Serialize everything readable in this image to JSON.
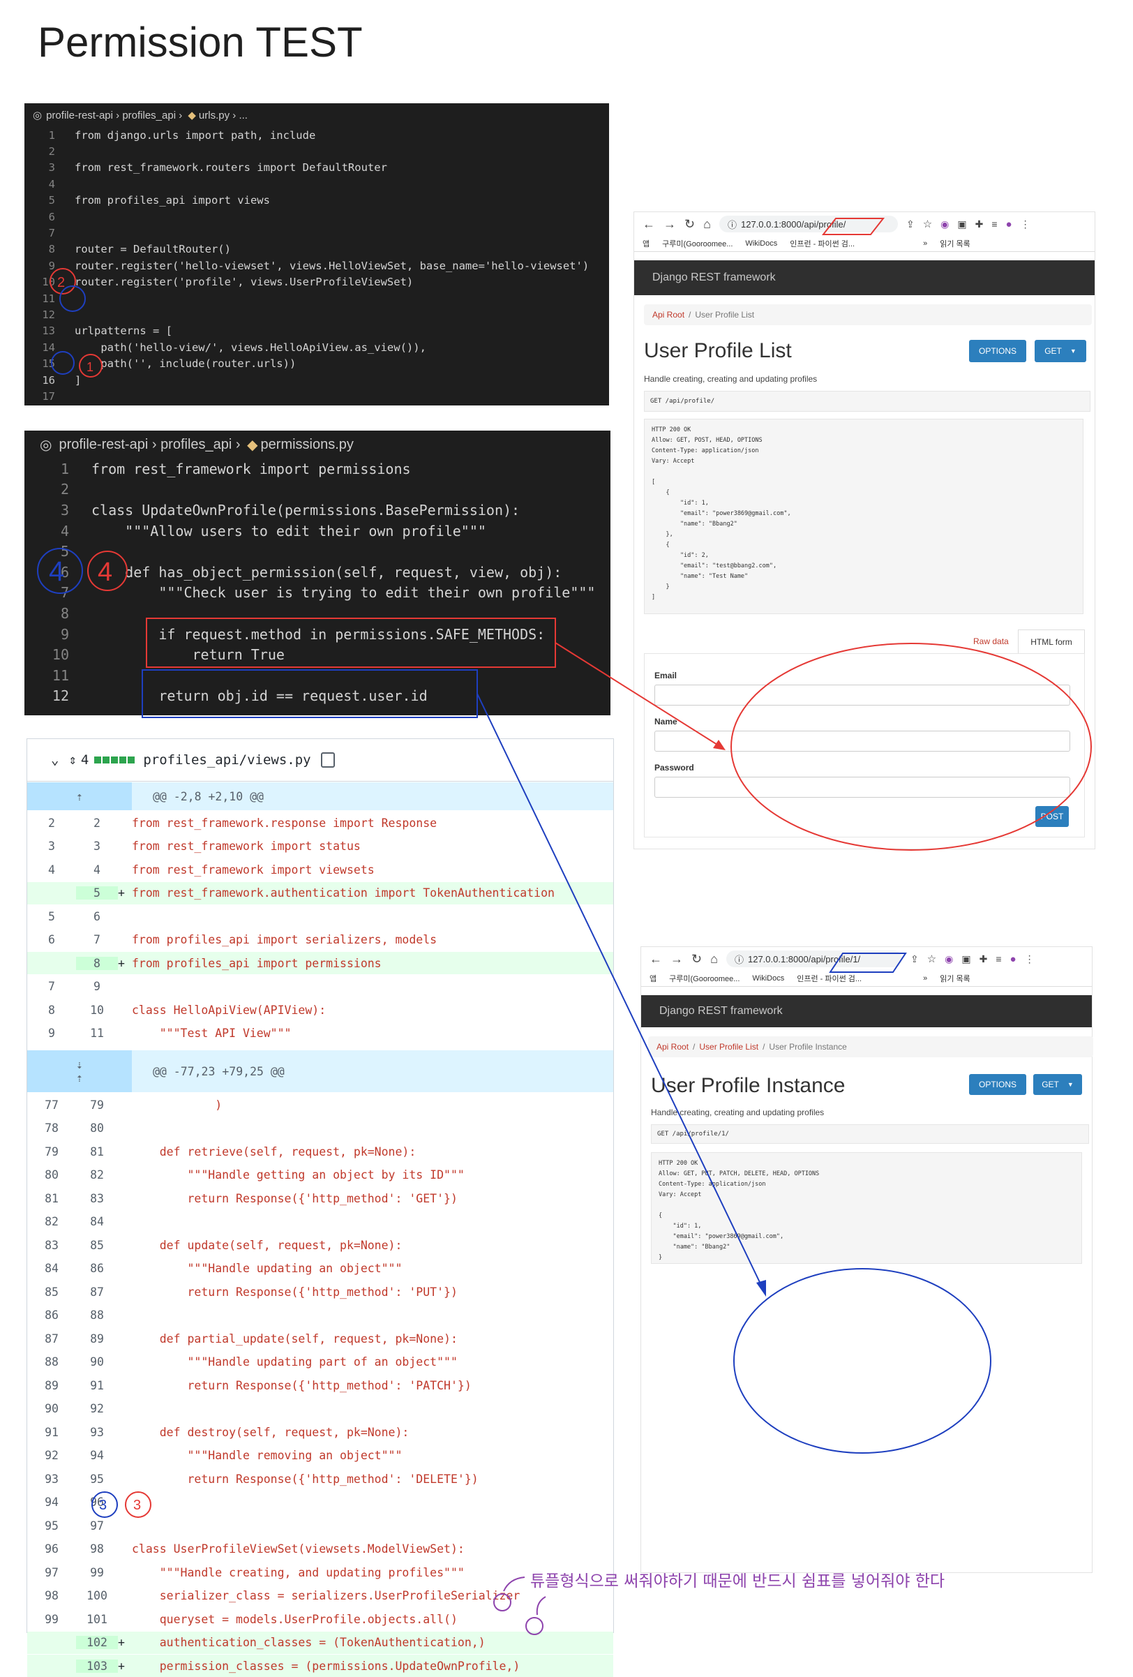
{
  "page": {
    "title": "Permission TEST"
  },
  "urls_editor": {
    "breadcrumb": [
      "profile-rest-api",
      "profiles_api",
      "urls.py",
      "..."
    ],
    "lines": [
      {
        "n": "1",
        "code": "from django.urls import path, include"
      },
      {
        "n": "2",
        "code": ""
      },
      {
        "n": "3",
        "code": "from rest_framework.routers import DefaultRouter"
      },
      {
        "n": "4",
        "code": ""
      },
      {
        "n": "5",
        "code": "from profiles_api import views"
      },
      {
        "n": "6",
        "code": ""
      },
      {
        "n": "7",
        "code": ""
      },
      {
        "n": "8",
        "code": "router = DefaultRouter()"
      },
      {
        "n": "9",
        "code": "router.register('hello-viewset', views.HelloViewSet, base_name='hello-viewset')"
      },
      {
        "n": "10",
        "code": "router.register('profile', views.UserProfileViewSet)"
      },
      {
        "n": "11",
        "code": ""
      },
      {
        "n": "12",
        "code": ""
      },
      {
        "n": "13",
        "code": "urlpatterns = ["
      },
      {
        "n": "14",
        "code": "    path('hello-view/', views.HelloApiView.as_view()),"
      },
      {
        "n": "15",
        "code": "    path('', include(router.urls))"
      },
      {
        "n": "16",
        "code": "]"
      },
      {
        "n": "17",
        "code": ""
      }
    ]
  },
  "perm_editor": {
    "breadcrumb": [
      "profile-rest-api",
      "profiles_api",
      "permissions.py"
    ],
    "lines": [
      {
        "n": "1",
        "code": "from rest_framework import permissions"
      },
      {
        "n": "2",
        "code": ""
      },
      {
        "n": "3",
        "code": "class UpdateOwnProfile(permissions.BasePermission):"
      },
      {
        "n": "4",
        "code": "    \"\"\"Allow users to edit their own profile\"\"\""
      },
      {
        "n": "5",
        "code": ""
      },
      {
        "n": "6",
        "code": "    def has_object_permission(self, request, view, obj):"
      },
      {
        "n": "7",
        "code": "        \"\"\"Check user is trying to edit their own profile\"\"\""
      },
      {
        "n": "8",
        "code": ""
      },
      {
        "n": "9",
        "code": "        if request.method in permissions.SAFE_METHODS:"
      },
      {
        "n": "10",
        "code": "            return True"
      },
      {
        "n": "11",
        "code": ""
      },
      {
        "n": "12",
        "code": "        return obj.id == request.user.id"
      }
    ]
  },
  "diff": {
    "change_count": "4",
    "file": "profiles_api/views.py",
    "hunk1": "@@ -2,8 +2,10 @@",
    "hunk2": "@@ -77,23 +79,25 @@",
    "rows1": [
      {
        "o": "2",
        "n": "2",
        "s": "",
        "c": "from rest_framework.response import Response",
        "a": false
      },
      {
        "o": "3",
        "n": "3",
        "s": "",
        "c": "from rest_framework import status",
        "a": false
      },
      {
        "o": "4",
        "n": "4",
        "s": "",
        "c": "from rest_framework import viewsets",
        "a": false
      },
      {
        "o": "",
        "n": "5",
        "s": "+",
        "c": "from rest_framework.authentication import TokenAuthentication",
        "a": true
      },
      {
        "o": "5",
        "n": "6",
        "s": "",
        "c": "",
        "a": false
      },
      {
        "o": "6",
        "n": "7",
        "s": "",
        "c": "from profiles_api import serializers, models",
        "a": false
      },
      {
        "o": "",
        "n": "8",
        "s": "+",
        "c": "from profiles_api import permissions",
        "a": true
      },
      {
        "o": "7",
        "n": "9",
        "s": "",
        "c": "",
        "a": false
      },
      {
        "o": "8",
        "n": "10",
        "s": "",
        "c": "class HelloApiView(APIView):",
        "a": false
      },
      {
        "o": "9",
        "n": "11",
        "s": "",
        "c": "    \"\"\"Test API View\"\"\"",
        "a": false
      }
    ],
    "rows2": [
      {
        "o": "77",
        "n": "79",
        "s": "",
        "c": "            )",
        "a": false
      },
      {
        "o": "78",
        "n": "80",
        "s": "",
        "c": "",
        "a": false
      },
      {
        "o": "79",
        "n": "81",
        "s": "",
        "c": "    def retrieve(self, request, pk=None):",
        "a": false
      },
      {
        "o": "80",
        "n": "82",
        "s": "",
        "c": "        \"\"\"Handle getting an object by its ID\"\"\"",
        "a": false
      },
      {
        "o": "81",
        "n": "83",
        "s": "",
        "c": "        return Response({'http_method': 'GET'})",
        "a": false
      },
      {
        "o": "82",
        "n": "84",
        "s": "",
        "c": "",
        "a": false
      },
      {
        "o": "83",
        "n": "85",
        "s": "",
        "c": "    def update(self, request, pk=None):",
        "a": false
      },
      {
        "o": "84",
        "n": "86",
        "s": "",
        "c": "        \"\"\"Handle updating an object\"\"\"",
        "a": false
      },
      {
        "o": "85",
        "n": "87",
        "s": "",
        "c": "        return Response({'http_method': 'PUT'})",
        "a": false
      },
      {
        "o": "86",
        "n": "88",
        "s": "",
        "c": "",
        "a": false
      },
      {
        "o": "87",
        "n": "89",
        "s": "",
        "c": "    def partial_update(self, request, pk=None):",
        "a": false
      },
      {
        "o": "88",
        "n": "90",
        "s": "",
        "c": "        \"\"\"Handle updating part of an object\"\"\"",
        "a": false
      },
      {
        "o": "89",
        "n": "91",
        "s": "",
        "c": "        return Response({'http_method': 'PATCH'})",
        "a": false
      },
      {
        "o": "90",
        "n": "92",
        "s": "",
        "c": "",
        "a": false
      },
      {
        "o": "91",
        "n": "93",
        "s": "",
        "c": "    def destroy(self, request, pk=None):",
        "a": false
      },
      {
        "o": "92",
        "n": "94",
        "s": "",
        "c": "        \"\"\"Handle removing an object\"\"\"",
        "a": false
      },
      {
        "o": "93",
        "n": "95",
        "s": "",
        "c": "        return Response({'http_method': 'DELETE'})",
        "a": false
      },
      {
        "o": "94",
        "n": "96",
        "s": "",
        "c": "",
        "a": false
      },
      {
        "o": "95",
        "n": "97",
        "s": "",
        "c": "",
        "a": false
      },
      {
        "o": "96",
        "n": "98",
        "s": "",
        "c": "class UserProfileViewSet(viewsets.ModelViewSet):",
        "a": false
      },
      {
        "o": "97",
        "n": "99",
        "s": "",
        "c": "    \"\"\"Handle creating, and updating profiles\"\"\"",
        "a": false
      },
      {
        "o": "98",
        "n": "100",
        "s": "",
        "c": "    serializer_class = serializers.UserProfileSerializer",
        "a": false
      },
      {
        "o": "99",
        "n": "101",
        "s": "",
        "c": "    queryset = models.UserProfile.objects.all()",
        "a": false
      },
      {
        "o": "",
        "n": "102",
        "s": "+",
        "c": "    authentication_classes = (TokenAuthentication,)",
        "a": true
      },
      {
        "o": "",
        "n": "103",
        "s": "+",
        "c": "    permission_classes = (permissions.UpdateOwnProfile,)",
        "a": true
      }
    ]
  },
  "browser1": {
    "url": "127.0.0.1:8000/api/profile/",
    "bookmarks": [
      "앱",
      "구루미(Gooroomee...",
      "WikiDocs",
      "인프런 - 파이썬 검...",
      "»",
      "읽기 목록"
    ],
    "brand": "Django REST framework",
    "crumb_root": "Api Root",
    "crumb_current": "User Profile List",
    "title": "User Profile List",
    "options": "OPTIONS",
    "get": "GET",
    "description": "Handle creating, creating and updating profiles",
    "request": "GET /api/profile/",
    "response": "HTTP 200 OK\nAllow: GET, POST, HEAD, OPTIONS\nContent-Type: application/json\nVary: Accept\n\n[\n    {\n        \"id\": 1,\n        \"email\": \"power3869@gmail.com\",\n        \"name\": \"Bbang2\"\n    },\n    {\n        \"id\": 2,\n        \"email\": \"test@bbang2.com\",\n        \"name\": \"Test Name\"\n    }\n]",
    "tab_raw": "Raw data",
    "tab_html": "HTML form",
    "label_email": "Email",
    "label_name": "Name",
    "label_password": "Password",
    "post": "POST"
  },
  "browser2": {
    "url": "127.0.0.1:8000/api/profile/1/",
    "bookmarks": [
      "앱",
      "구루미(Gooroomee...",
      "WikiDocs",
      "인프런 - 파이썬 검...",
      "»",
      "읽기 목록"
    ],
    "brand": "Django REST framework",
    "crumb_root": "Api Root",
    "crumb_list": "User Profile List",
    "crumb_current": "User Profile Instance",
    "title": "User Profile Instance",
    "options": "OPTIONS",
    "get": "GET",
    "description": "Handle creating, creating and updating profiles",
    "request": "GET /api/profile/1/",
    "response": "HTTP 200 OK\nAllow: GET, PUT, PATCH, DELETE, HEAD, OPTIONS\nContent-Type: application/json\nVary: Accept\n\n{\n    \"id\": 1,\n    \"email\": \"power3869@gmail.com\",\n    \"name\": \"Bbang2\"\n}"
  },
  "annotations": {
    "note": "튜플형식으로 써줘야하기 때문에 반드시 쉼표를 넣어줘야 한다",
    "m1": "1",
    "m2": "2",
    "m3": "3",
    "m4": "4",
    "colors": {
      "red": "#e53935",
      "blue": "#1e3fbf",
      "purple": "#8e44ad"
    }
  }
}
